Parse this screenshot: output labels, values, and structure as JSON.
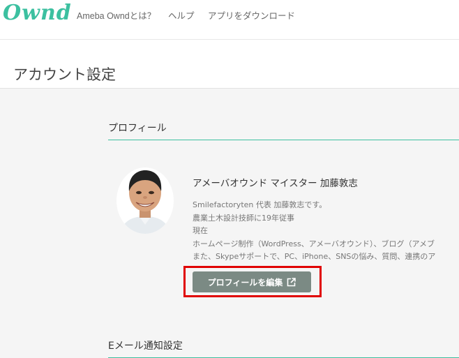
{
  "header": {
    "logo": "Ownd",
    "nav": [
      "Ameba Owndとは？",
      "ヘルプ",
      "アプリをダウンロード"
    ]
  },
  "page": {
    "title": "アカウント設定"
  },
  "profile": {
    "section_title": "プロフィール",
    "name": "アメーバオウンド マイスター 加藤敦志",
    "description": [
      "Smilefactoryten 代表 加藤敦志です。",
      "農業土木設計技師に19年従事",
      "現在",
      "ホームページ制作（WordPress、アメーバオウンド）、ブログ（アメブ",
      "また、Skypeサポートで、PC、iPhone、SNSの悩み、質問、連携のア"
    ],
    "edit_button": "プロフィールを編集"
  },
  "email_section": {
    "title": "Eメール通知設定"
  },
  "colors": {
    "accent": "#3cc0a0",
    "button": "#7b8a84",
    "highlight": "#e00000"
  },
  "icons": {
    "edit_button": "external-link-icon"
  }
}
